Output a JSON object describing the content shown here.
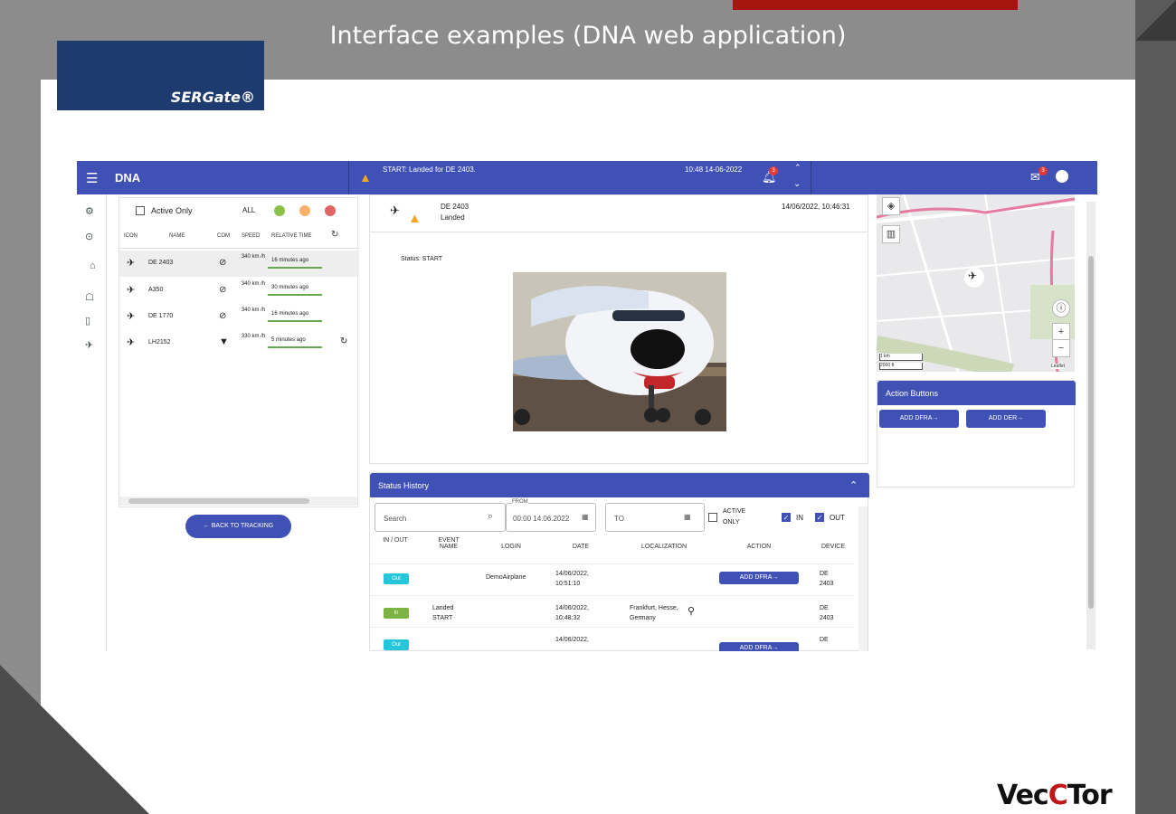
{
  "slide": {
    "title": "Interface examples (DNA web application)",
    "logo_text": "SERGate®",
    "footer_brand_a": "Vec",
    "footer_brand_b": "C",
    "footer_brand_c": "Tor"
  },
  "topbar": {
    "app_title": "DNA",
    "notification": "START: Landed for DE 2403.",
    "datetime": "10:48 14-06-2022",
    "bell_badge": "3",
    "mail_badge": "3"
  },
  "vehicle_list": {
    "active_only_label": "Active Only",
    "all_label": "ALL",
    "status_colors": [
      "#8bc34a",
      "#f6b26b",
      "#e06666"
    ],
    "columns": [
      "ICON",
      "NAME",
      "COM",
      "SPEED",
      "RELATIVE TIME"
    ],
    "rows": [
      {
        "name": "DE 2403",
        "speed": "340 km /h",
        "time": "16 minutes ago",
        "selected": true
      },
      {
        "name": "A350",
        "speed": "340 km /h",
        "time": "30 minutes ago",
        "selected": false
      },
      {
        "name": "DE 1770",
        "speed": "340 km /h",
        "time": "16 minutes ago",
        "selected": false
      },
      {
        "name": "LH2152",
        "speed": "330 km /h",
        "time": "5 minutes ago",
        "selected": false
      }
    ],
    "back_button": "BACK TO TRACKING"
  },
  "detail": {
    "flight": "DE 2403",
    "state": "Landed",
    "timestamp": "14/06/2022, 10:46:31",
    "status_line": "Status: START"
  },
  "status_history": {
    "title": "Status History",
    "search_placeholder": "Search",
    "from_label": "FROM",
    "from_value": "00:00 14.06.2022",
    "to_placeholder": "TO",
    "active_only": "ACTIVE ONLY",
    "in_label": "IN",
    "out_label": "OUT",
    "columns": [
      "IN / OUT",
      "EVENT NAME",
      "LOGIN",
      "DATE",
      "LOCALIZATION",
      "ACTION",
      "DEVICE"
    ],
    "rows": [
      {
        "tag": "Out",
        "tag_color": "#26c6da",
        "event": "",
        "login": "DemoAirplane",
        "date": "14/06/2022, 10:51:10",
        "loc": "",
        "action": "ADD DFRA→",
        "device": "DE 2403"
      },
      {
        "tag": "In",
        "tag_color": "#7cb342",
        "event": "Landed START",
        "login": "",
        "date": "14/06/2022, 10:48:32",
        "loc": "Frankfurt, Hesse, Germany",
        "action": "",
        "device": "DE 2403"
      },
      {
        "tag": "Out",
        "tag_color": "#26c6da",
        "event": "",
        "login": "",
        "date": "14/06/2022,",
        "loc": "",
        "action": "ADD DFRA→",
        "device": "DE"
      }
    ]
  },
  "map": {
    "scale_a": "1 km",
    "scale_b": "2000 ft",
    "attribution": "Leaflet"
  },
  "action_buttons": {
    "title": "Action Buttons",
    "buttons": [
      "ADD DFRA→",
      "ADD DER→"
    ]
  }
}
